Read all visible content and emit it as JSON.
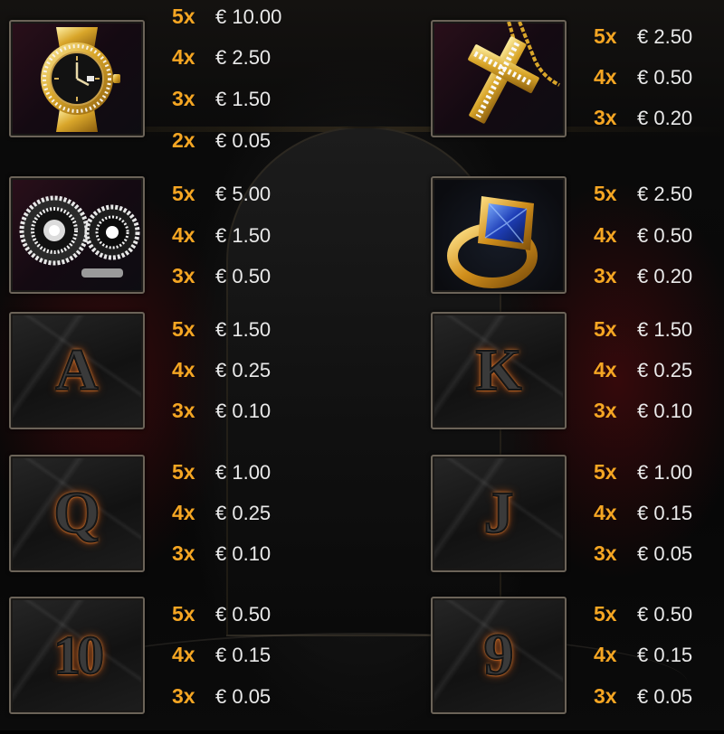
{
  "paytable": {
    "symbols": [
      {
        "id": "watch",
        "icon": "gold-diamond-watch-icon",
        "payouts": [
          {
            "mult": "5x",
            "amount": "€ 10.00"
          },
          {
            "mult": "4x",
            "amount": "€ 2.50"
          },
          {
            "mult": "3x",
            "amount": "€ 1.50"
          },
          {
            "mult": "2x",
            "amount": "€ 0.05"
          }
        ]
      },
      {
        "id": "cross",
        "icon": "gold-cross-pendant-icon",
        "payouts": [
          {
            "mult": "5x",
            "amount": "€ 2.50"
          },
          {
            "mult": "4x",
            "amount": "€ 0.50"
          },
          {
            "mult": "3x",
            "amount": "€ 0.20"
          }
        ]
      },
      {
        "id": "earrings",
        "icon": "diamond-earrings-icon",
        "payouts": [
          {
            "mult": "5x",
            "amount": "€ 5.00"
          },
          {
            "mult": "4x",
            "amount": "€ 1.50"
          },
          {
            "mult": "3x",
            "amount": "€ 0.50"
          }
        ]
      },
      {
        "id": "ring",
        "icon": "sapphire-gold-ring-icon",
        "payouts": [
          {
            "mult": "5x",
            "amount": "€ 2.50"
          },
          {
            "mult": "4x",
            "amount": "€ 0.50"
          },
          {
            "mult": "3x",
            "amount": "€ 0.20"
          }
        ]
      },
      {
        "id": "ace",
        "icon": "card-ace-icon",
        "letter": "A",
        "payouts": [
          {
            "mult": "5x",
            "amount": "€ 1.50"
          },
          {
            "mult": "4x",
            "amount": "€ 0.25"
          },
          {
            "mult": "3x",
            "amount": "€ 0.10"
          }
        ]
      },
      {
        "id": "king",
        "icon": "card-king-icon",
        "letter": "K",
        "payouts": [
          {
            "mult": "5x",
            "amount": "€ 1.50"
          },
          {
            "mult": "4x",
            "amount": "€ 0.25"
          },
          {
            "mult": "3x",
            "amount": "€ 0.10"
          }
        ]
      },
      {
        "id": "queen",
        "icon": "card-queen-icon",
        "letter": "Q",
        "payouts": [
          {
            "mult": "5x",
            "amount": "€ 1.00"
          },
          {
            "mult": "4x",
            "amount": "€ 0.25"
          },
          {
            "mult": "3x",
            "amount": "€ 0.10"
          }
        ]
      },
      {
        "id": "jack",
        "icon": "card-jack-icon",
        "letter": "J",
        "payouts": [
          {
            "mult": "5x",
            "amount": "€ 1.00"
          },
          {
            "mult": "4x",
            "amount": "€ 0.15"
          },
          {
            "mult": "3x",
            "amount": "€ 0.05"
          }
        ]
      },
      {
        "id": "ten",
        "icon": "card-ten-icon",
        "letter": "10",
        "payouts": [
          {
            "mult": "5x",
            "amount": "€ 0.50"
          },
          {
            "mult": "4x",
            "amount": "€ 0.15"
          },
          {
            "mult": "3x",
            "amount": "€ 0.05"
          }
        ]
      },
      {
        "id": "nine",
        "icon": "card-nine-icon",
        "letter": "9",
        "payouts": [
          {
            "mult": "5x",
            "amount": "€ 0.50"
          },
          {
            "mult": "4x",
            "amount": "€ 0.15"
          },
          {
            "mult": "3x",
            "amount": "€ 0.05"
          }
        ]
      }
    ]
  },
  "colors": {
    "multiplier": "#f5a623",
    "amount": "#eaeaea",
    "card_glow": "#e07b2a",
    "background": "#000000"
  }
}
